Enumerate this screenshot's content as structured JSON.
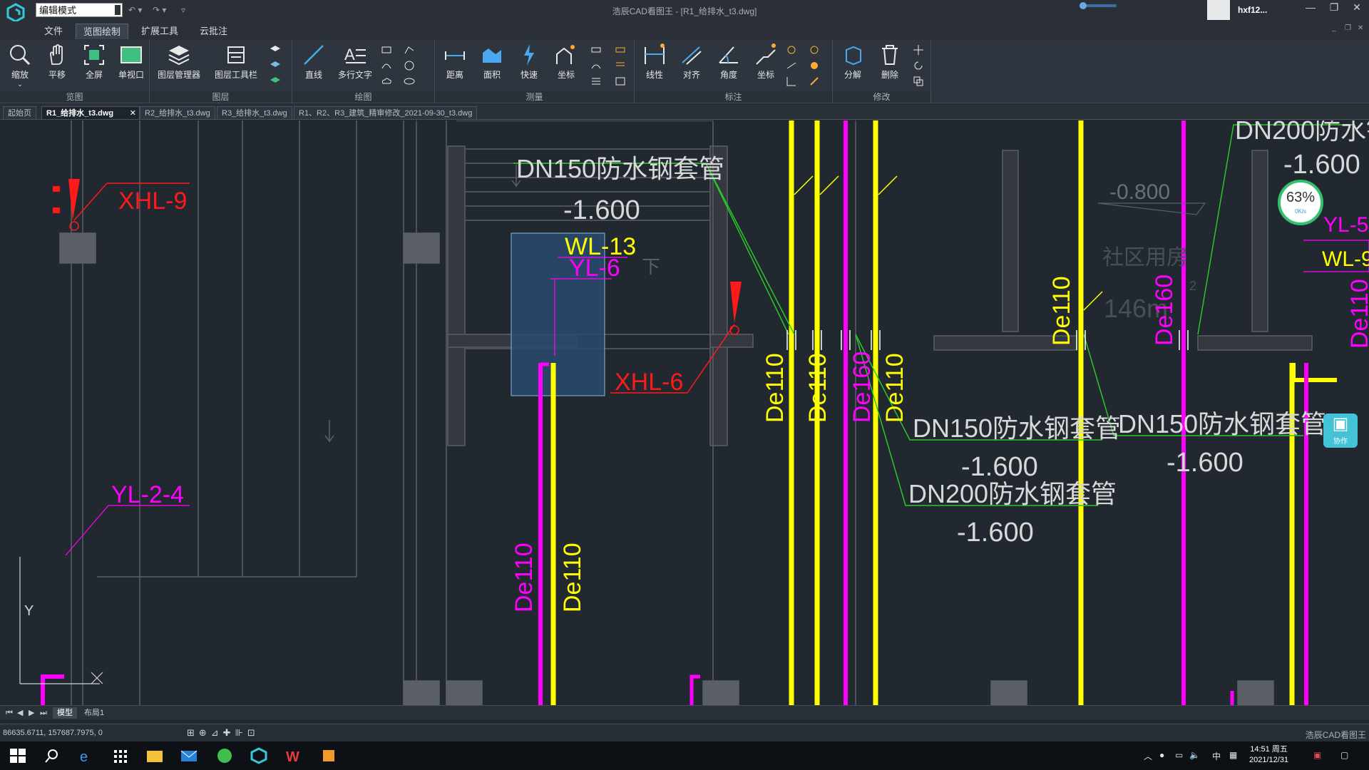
{
  "app": {
    "window_title": "浩辰CAD看图王 - [R1_给排水_t3.dwg]",
    "mode": "编辑模式",
    "user": "hxf12...",
    "status_app": "浩辰CAD看图王"
  },
  "menus": [
    "文件",
    "览图绘制",
    "扩展工具",
    "云批注"
  ],
  "ribbon": {
    "groups": [
      "览图",
      "图层",
      "绘图",
      "测量",
      "标注",
      "修改"
    ],
    "tools": {
      "zoom": "缩放",
      "pan": "平移",
      "fullscreen": "全屏",
      "single_viewport": "单视口",
      "layer_manager": "图层管理器",
      "layer_toolbar": "图层工具栏",
      "line": "直线",
      "mtext": "多行文字",
      "distance": "距离",
      "area": "面积",
      "quick": "快速",
      "coordinate": "坐标",
      "linear": "线性",
      "aligned": "对齐",
      "angle": "角度",
      "coordinate2": "坐标",
      "explode": "分解",
      "delete": "删除"
    }
  },
  "doc_tabs": [
    "起始页",
    "R1_给排水_t3.dwg",
    "R2_给排水_t3.dwg",
    "R3_给排水_t3.dwg",
    "R1、R2、R3_建筑_精审修改_2021-09-30_t3.dwg"
  ],
  "layout_tabs": [
    "模型",
    "布局1"
  ],
  "coords": "86635.6711, 157687.7975, 0",
  "speed": {
    "percent": "63%",
    "rate": "0K/s"
  },
  "collab": "协作",
  "taskbar": {
    "time": "14:51 周五",
    "date": "2021/12/31",
    "ime": "中"
  },
  "colors": {
    "yellow": "#ffff00",
    "magenta": "#ff00ff",
    "red": "#ff1a1a",
    "green": "#28c828",
    "grey": "#5a5f66"
  },
  "drawing": {
    "labels": {
      "xhl9": "XHL-9",
      "xhl6": "XHL-6",
      "wl13": "WL-13",
      "yl6": "YL-6",
      "yl24": "YL-2-4",
      "down": "下",
      "dn150_a": "DN150防水钢套管",
      "el_a": "-1.600",
      "dn150_b": "DN150防水钢套管",
      "el_b": "-1.600",
      "dn150_c": "DN150防水钢套管",
      "el_c": "-1.600",
      "dn200_a": "DN200防水钢套管",
      "el_d": "-1.600",
      "dn200_top": "DN200防水钢",
      "el_top": "-1.600",
      "el_080": "-0.800",
      "de110_a": "De110",
      "de110_b": "De110",
      "de110_c": "De110",
      "de110_d": "De110",
      "de110_e": "De110",
      "de110_f": "De110",
      "de160_a": "De160",
      "de160_b": "De160",
      "yl5": "YL-5",
      "wl9": "WL-9",
      "de11x": "De110",
      "community": "社区用房",
      "area": "146m",
      "sup": "2",
      "ucs_y": "Y"
    }
  }
}
